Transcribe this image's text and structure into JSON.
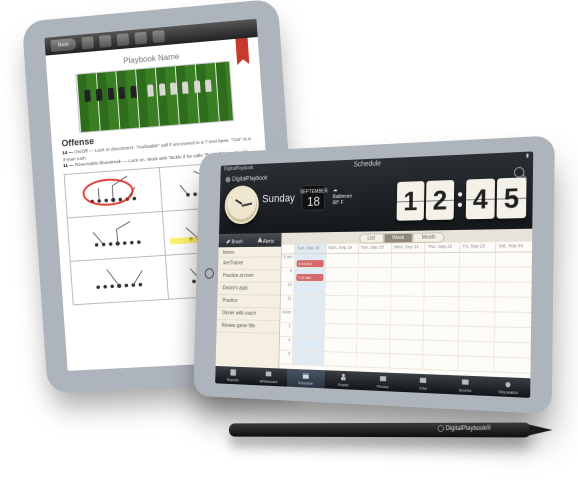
{
  "tablet_left": {
    "back_label": "Back",
    "title": "Playbook Name",
    "section_heading": "Offense",
    "line1_prefix": "14 —",
    "line1_text": "On/Off — Lock or disconnect. \"Audioable\" call if uncovered in a T-end base. \"Out\" is a 3-man rush.",
    "line2_prefix": "11 —",
    "line2_text": "Reversable Bluestreak — Lock on. Work with Tackle if he calls \"Reducible\" or \"Lurk\"."
  },
  "tablet_right": {
    "status_app": "DigitalPlaybook",
    "header_title": "Schedule",
    "brand": "DigitalPlaybook",
    "day_name": "Sunday",
    "date_month": "SEPTEMBER",
    "date_day": "18",
    "weather_city": "Baltimore",
    "weather_temp": "68° F",
    "clock_digits": [
      "1",
      "2",
      "4",
      "5"
    ],
    "notes": {
      "brush_label": "Brush",
      "alerts_label": "Alerts",
      "heading": "Notes",
      "items": [
        "Ike/Trainer",
        "Practice at noon",
        "Doctor's appt.",
        "Practice",
        "Dinner with coach",
        "Review game film"
      ]
    },
    "view_tabs": {
      "list": "List",
      "week": "Week",
      "month": "Month"
    },
    "week_days": [
      "Sun, Sep 18",
      "Mon, Sep 19",
      "Tue, Sep 20",
      "Wed, Sep 21",
      "Thu, Sep 22",
      "Fri, Sep 23",
      "Sat, Sep 24"
    ],
    "hours": [
      "8 am",
      "9",
      "10",
      "11",
      "noon",
      "1",
      "2",
      "3"
    ],
    "events": [
      {
        "label": "5:15 AM",
        "color": "#d46a6a"
      },
      {
        "label": "7:11 AM",
        "color": "#d46a6a"
      }
    ],
    "dock": [
      "Reports",
      "Whiteboard",
      "Schedule",
      "Roster",
      "Photos",
      "Film",
      "Scores",
      "Stopwatch"
    ]
  },
  "stylus_brand": "DigitalPlaybook®"
}
